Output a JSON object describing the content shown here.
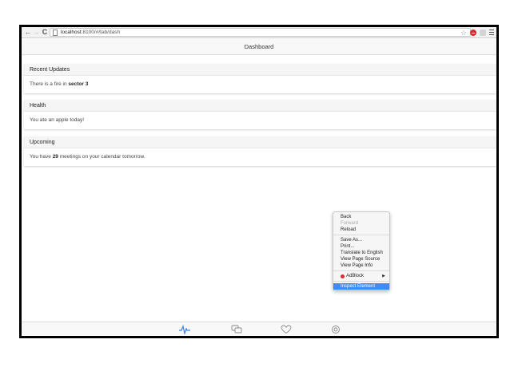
{
  "browser": {
    "back_glyph": "←",
    "forward_glyph": "→",
    "reload_glyph": "C",
    "url_host": "localhost",
    "url_rest": ":8100/#/tab/dash",
    "star_glyph": "☆",
    "icons": [
      "back-icon",
      "forward-icon",
      "reload-icon",
      "page-icon",
      "star-icon",
      "adblock-icon",
      "extension-icon",
      "menu-icon"
    ]
  },
  "app": {
    "title": "Dashboard"
  },
  "cards": [
    {
      "header": "Recent Updates",
      "body_prefix": "There is a fire in ",
      "body_strong": "sector 3",
      "body_suffix": ""
    },
    {
      "header": "Health",
      "body_prefix": "You ate an apple today!",
      "body_strong": "",
      "body_suffix": ""
    },
    {
      "header": "Upcoming",
      "body_prefix": "You have ",
      "body_strong": "29",
      "body_suffix": " meetings on your calendar tomorrow."
    }
  ],
  "tabs": [
    {
      "icon": "pulse-icon",
      "active": true
    },
    {
      "icon": "chat-icon",
      "active": false
    },
    {
      "icon": "heart-icon",
      "active": false
    },
    {
      "icon": "settings-icon",
      "active": false
    }
  ],
  "context_menu": {
    "back": "Back",
    "forward": "Forward",
    "reload": "Reload",
    "save_as": "Save As...",
    "print": "Print...",
    "translate": "Translate to English",
    "view_source": "View Page Source",
    "view_info": "View Page Info",
    "adblock": "AdBlock",
    "adblock_arrow": "▶",
    "inspect": "Inspect Element"
  },
  "colors": {
    "active_tab": "#387ef5",
    "inactive_tab": "#8a8a8a",
    "menu_highlight": "#3d8cf3"
  }
}
